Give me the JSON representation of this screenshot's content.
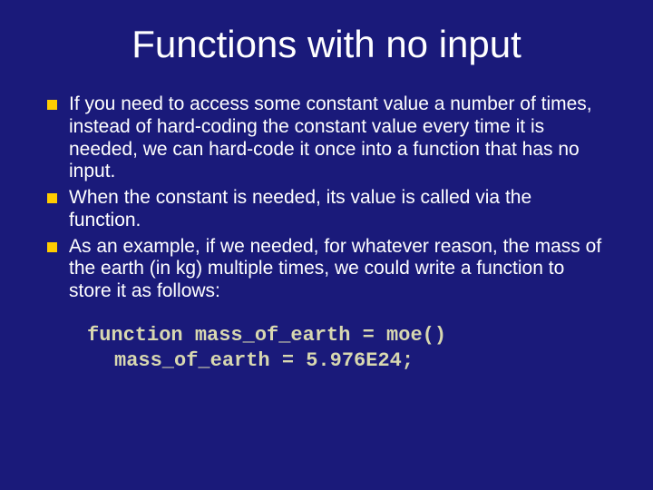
{
  "title": "Functions with no input",
  "bullets": [
    "If you need to access some constant value a number of times, instead of hard-coding the constant value every time it is needed, we can hard-code it once into a function that has no input.",
    "When the constant is needed, its value is called via the function.",
    "As an example, if we needed, for whatever reason, the mass of the earth (in kg) multiple times, we could write a function to store it as follows:"
  ],
  "code": {
    "line1": "function mass_of_earth = moe()",
    "line2": "mass_of_earth = 5.976E24;"
  }
}
